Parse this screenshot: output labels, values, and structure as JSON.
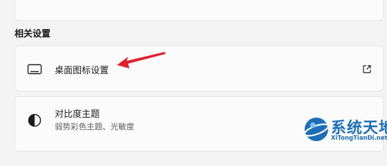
{
  "related_settings": {
    "title": "相关设置",
    "items": [
      {
        "label": "桌面图标设置",
        "icon": "monitor-icon",
        "action_icon": "external-link-icon"
      },
      {
        "label": "对比度主题",
        "sublabel": "弱势彩色主题、光敏度",
        "icon": "contrast-icon"
      }
    ]
  },
  "annotation": {
    "arrow_color": "#e0202c"
  },
  "watermark": {
    "text": "系统天地",
    "subtext": "XiTongTianDi.net",
    "color": "#1d6fb8"
  }
}
